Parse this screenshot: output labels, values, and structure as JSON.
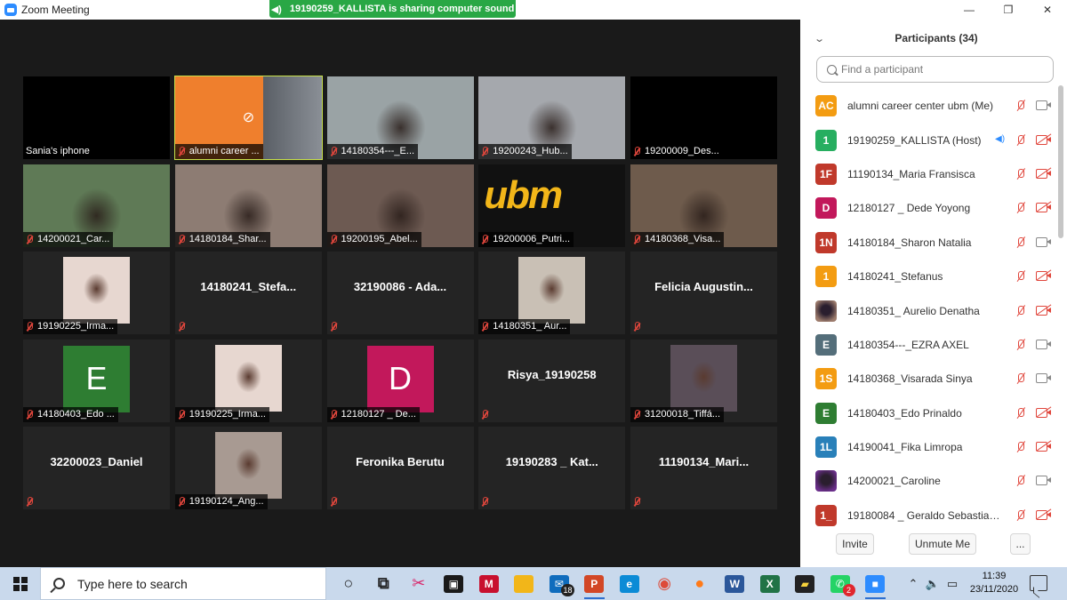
{
  "window": {
    "title": "Zoom Meeting"
  },
  "share_banner": "19190259_KALLISTA is sharing computer sound",
  "tiles": [
    {
      "label": "Sania's iphone",
      "muted": false,
      "kind": "video",
      "bg": "#000000"
    },
    {
      "label": "alumni career ...",
      "muted": true,
      "kind": "share",
      "bg": "#ef7f2d",
      "active": true
    },
    {
      "label": "14180354---_E...",
      "muted": true,
      "kind": "video",
      "bg": "#9aa3a5"
    },
    {
      "label": "19200243_Hub...",
      "muted": true,
      "kind": "video",
      "bg": "#a5a8ad"
    },
    {
      "label": "19200009_Des...",
      "muted": true,
      "kind": "video",
      "bg": "#000000"
    },
    {
      "label": "14200021_Car...",
      "muted": true,
      "kind": "video",
      "bg": "#5f7a56"
    },
    {
      "label": "14180184_Shar...",
      "muted": true,
      "kind": "video",
      "bg": "#8d7c73"
    },
    {
      "label": "19200195_Abel...",
      "muted": true,
      "kind": "video",
      "bg": "#6d5a52"
    },
    {
      "label": "19200006_Putri...",
      "muted": true,
      "kind": "ubm",
      "bg": "#111111",
      "logo": "ubm"
    },
    {
      "label": "14180368_Visa...",
      "muted": true,
      "kind": "video",
      "bg": "#6e5b4c"
    },
    {
      "label": "19190225_Irma...",
      "muted": true,
      "kind": "photo",
      "photo": "#e7d7d0"
    },
    {
      "label": "",
      "name": "14180241_Stefa...",
      "muted": true,
      "kind": "name"
    },
    {
      "label": "",
      "name": "32190086 - Ada...",
      "muted": true,
      "kind": "name"
    },
    {
      "label": "14180351_ Aur...",
      "muted": true,
      "kind": "photo",
      "photo": "#c9c0b5"
    },
    {
      "label": "",
      "name": "Felicia  Augustin...",
      "muted": true,
      "kind": "name"
    },
    {
      "label": "14180403_Edo ...",
      "muted": true,
      "kind": "letter",
      "letter": "E",
      "color": "#2e7d32"
    },
    {
      "label": "19190225_Irma...",
      "muted": true,
      "kind": "photo",
      "photo": "#e7d7d0"
    },
    {
      "label": "12180127 _ De...",
      "muted": true,
      "kind": "letter",
      "letter": "D",
      "color": "#c2185b"
    },
    {
      "label": "",
      "name": "Risya_19190258",
      "muted": true,
      "kind": "name"
    },
    {
      "label": "31200018_Tiffá...",
      "muted": true,
      "kind": "photo",
      "photo": "#5a4e58"
    },
    {
      "label": "",
      "name": "32200023_Daniel",
      "muted": true,
      "kind": "name"
    },
    {
      "label": "19190124_Ang...",
      "muted": true,
      "kind": "photo",
      "photo": "#a89a92"
    },
    {
      "label": "",
      "name": "Feronika Berutu",
      "muted": true,
      "kind": "name"
    },
    {
      "label": "",
      "name": "19190283 _ Kat...",
      "muted": true,
      "kind": "name"
    },
    {
      "label": "",
      "name": "11190134_Mari...",
      "muted": true,
      "kind": "name"
    }
  ],
  "panel": {
    "title": "Participants (34)",
    "search_placeholder": "Find a participant",
    "participants": [
      {
        "initials": "AC",
        "color": "#f39c12",
        "name": "alumni career center ubm (Me)",
        "cam": "on"
      },
      {
        "initials": "1",
        "color": "#27ae60",
        "name": "19190259_KALLISTA (Host)",
        "cam": "off",
        "speaking": true
      },
      {
        "initials": "1F",
        "color": "#c0392b",
        "name": "11190134_Maria Fransisca",
        "cam": "off"
      },
      {
        "initials": "D",
        "color": "#c2185b",
        "name": "12180127 _ Dede Yoyong",
        "cam": "off"
      },
      {
        "initials": "1N",
        "color": "#c0392b",
        "name": "14180184_Sharon Natalia",
        "cam": "on"
      },
      {
        "initials": "1",
        "color": "#f39c12",
        "name": "14180241_Stefanus",
        "cam": "off"
      },
      {
        "initials": "",
        "color": "#9c7b6c",
        "name": "14180351_ Aurelio Denatha",
        "cam": "off",
        "photo": true
      },
      {
        "initials": "E",
        "color": "#546e7a",
        "name": "14180354---_EZRA AXEL",
        "cam": "on"
      },
      {
        "initials": "1S",
        "color": "#f39c12",
        "name": "14180368_Visarada Sinya",
        "cam": "on"
      },
      {
        "initials": "E",
        "color": "#2e7d32",
        "name": "14180403_Edo Prinaldo",
        "cam": "off"
      },
      {
        "initials": "1L",
        "color": "#2980b9",
        "name": "14190041_Fika Limropa",
        "cam": "off"
      },
      {
        "initials": "",
        "color": "#6a2e8a",
        "name": "14200021_Caroline",
        "cam": "on",
        "photo": true
      },
      {
        "initials": "1_",
        "color": "#c0392b",
        "name": "19180084 _ Geraldo Sebastian ...",
        "cam": "off"
      }
    ],
    "invite_label": "Invite",
    "unmute_label": "Unmute Me",
    "more_label": "..."
  },
  "taskbar": {
    "search_placeholder": "Type here to search",
    "apps": [
      {
        "icon": "cortana-icon",
        "glyph": "○",
        "bg": "transparent",
        "fg": "#222"
      },
      {
        "icon": "task-view-icon",
        "glyph": "⧉",
        "bg": "transparent",
        "fg": "#222"
      },
      {
        "icon": "snip-icon",
        "glyph": "✂",
        "bg": "transparent",
        "fg": "#d9266b"
      },
      {
        "icon": "store-icon",
        "glyph": "▣",
        "bg": "#1a1a1a",
        "fg": "#fff"
      },
      {
        "icon": "mcafee-icon",
        "glyph": "M",
        "bg": "#c8102e",
        "fg": "#fff"
      },
      {
        "icon": "explorer-icon",
        "glyph": "▬",
        "bg": "#f2b619",
        "fg": "#f2b619"
      },
      {
        "icon": "mail-icon",
        "glyph": "✉",
        "bg": "#0f6cbd",
        "fg": "#fff",
        "badge": "18"
      },
      {
        "icon": "powerpoint-icon",
        "glyph": "P",
        "bg": "#d24726",
        "fg": "#fff",
        "run": true
      },
      {
        "icon": "edge-icon",
        "glyph": "e",
        "bg": "#0b8bd6",
        "fg": "#fff"
      },
      {
        "icon": "chrome-icon",
        "glyph": "◉",
        "bg": "transparent",
        "fg": "#dd4b39"
      },
      {
        "icon": "firefox-icon",
        "glyph": "●",
        "bg": "transparent",
        "fg": "#ff7a18"
      },
      {
        "icon": "word-icon",
        "glyph": "W",
        "bg": "#2b579a",
        "fg": "#fff"
      },
      {
        "icon": "excel-icon",
        "glyph": "X",
        "bg": "#217346",
        "fg": "#fff"
      },
      {
        "icon": "sticky-notes-icon",
        "glyph": "▰",
        "bg": "#222",
        "fg": "#f5d23c"
      },
      {
        "icon": "whatsapp-icon",
        "glyph": "✆",
        "bg": "#25d366",
        "fg": "#fff",
        "badge": "2",
        "badge_red": true
      },
      {
        "icon": "zoom-icon",
        "glyph": "■",
        "bg": "#2d8cff",
        "fg": "#fff",
        "run": true
      }
    ],
    "time": "11:39",
    "date": "23/11/2020"
  }
}
